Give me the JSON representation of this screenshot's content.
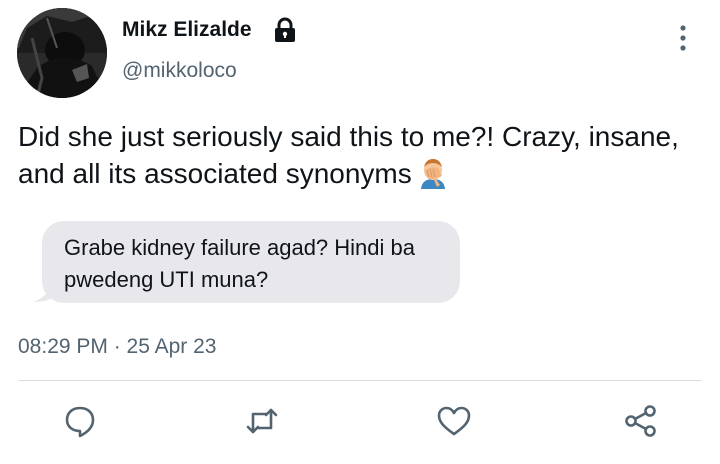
{
  "author": {
    "display_name": "Mikz Elizalde",
    "handle": "@mikkoloco",
    "verified_lock_icon": "lock-icon",
    "avatar_icon": "avatar"
  },
  "tweet": {
    "text": "Did she just seriously said this to me?! Crazy, insane, and all its associated synonyms",
    "emoji_icon": "facepalm-emoji-icon",
    "quoted_message": "Grabe kidney failure agad? Hindi ba pwedeng UTI muna?",
    "timestamp": "08:29 PM · 25 Apr 23"
  },
  "actions": [
    {
      "icon": "reply-icon"
    },
    {
      "icon": "retweet-icon"
    },
    {
      "icon": "like-icon"
    },
    {
      "icon": "share-icon"
    }
  ],
  "colors": {
    "text": "#0f1419",
    "secondary_text": "#536471",
    "bubble_bg": "#e8e8ec",
    "divider": "#d9dde0"
  }
}
